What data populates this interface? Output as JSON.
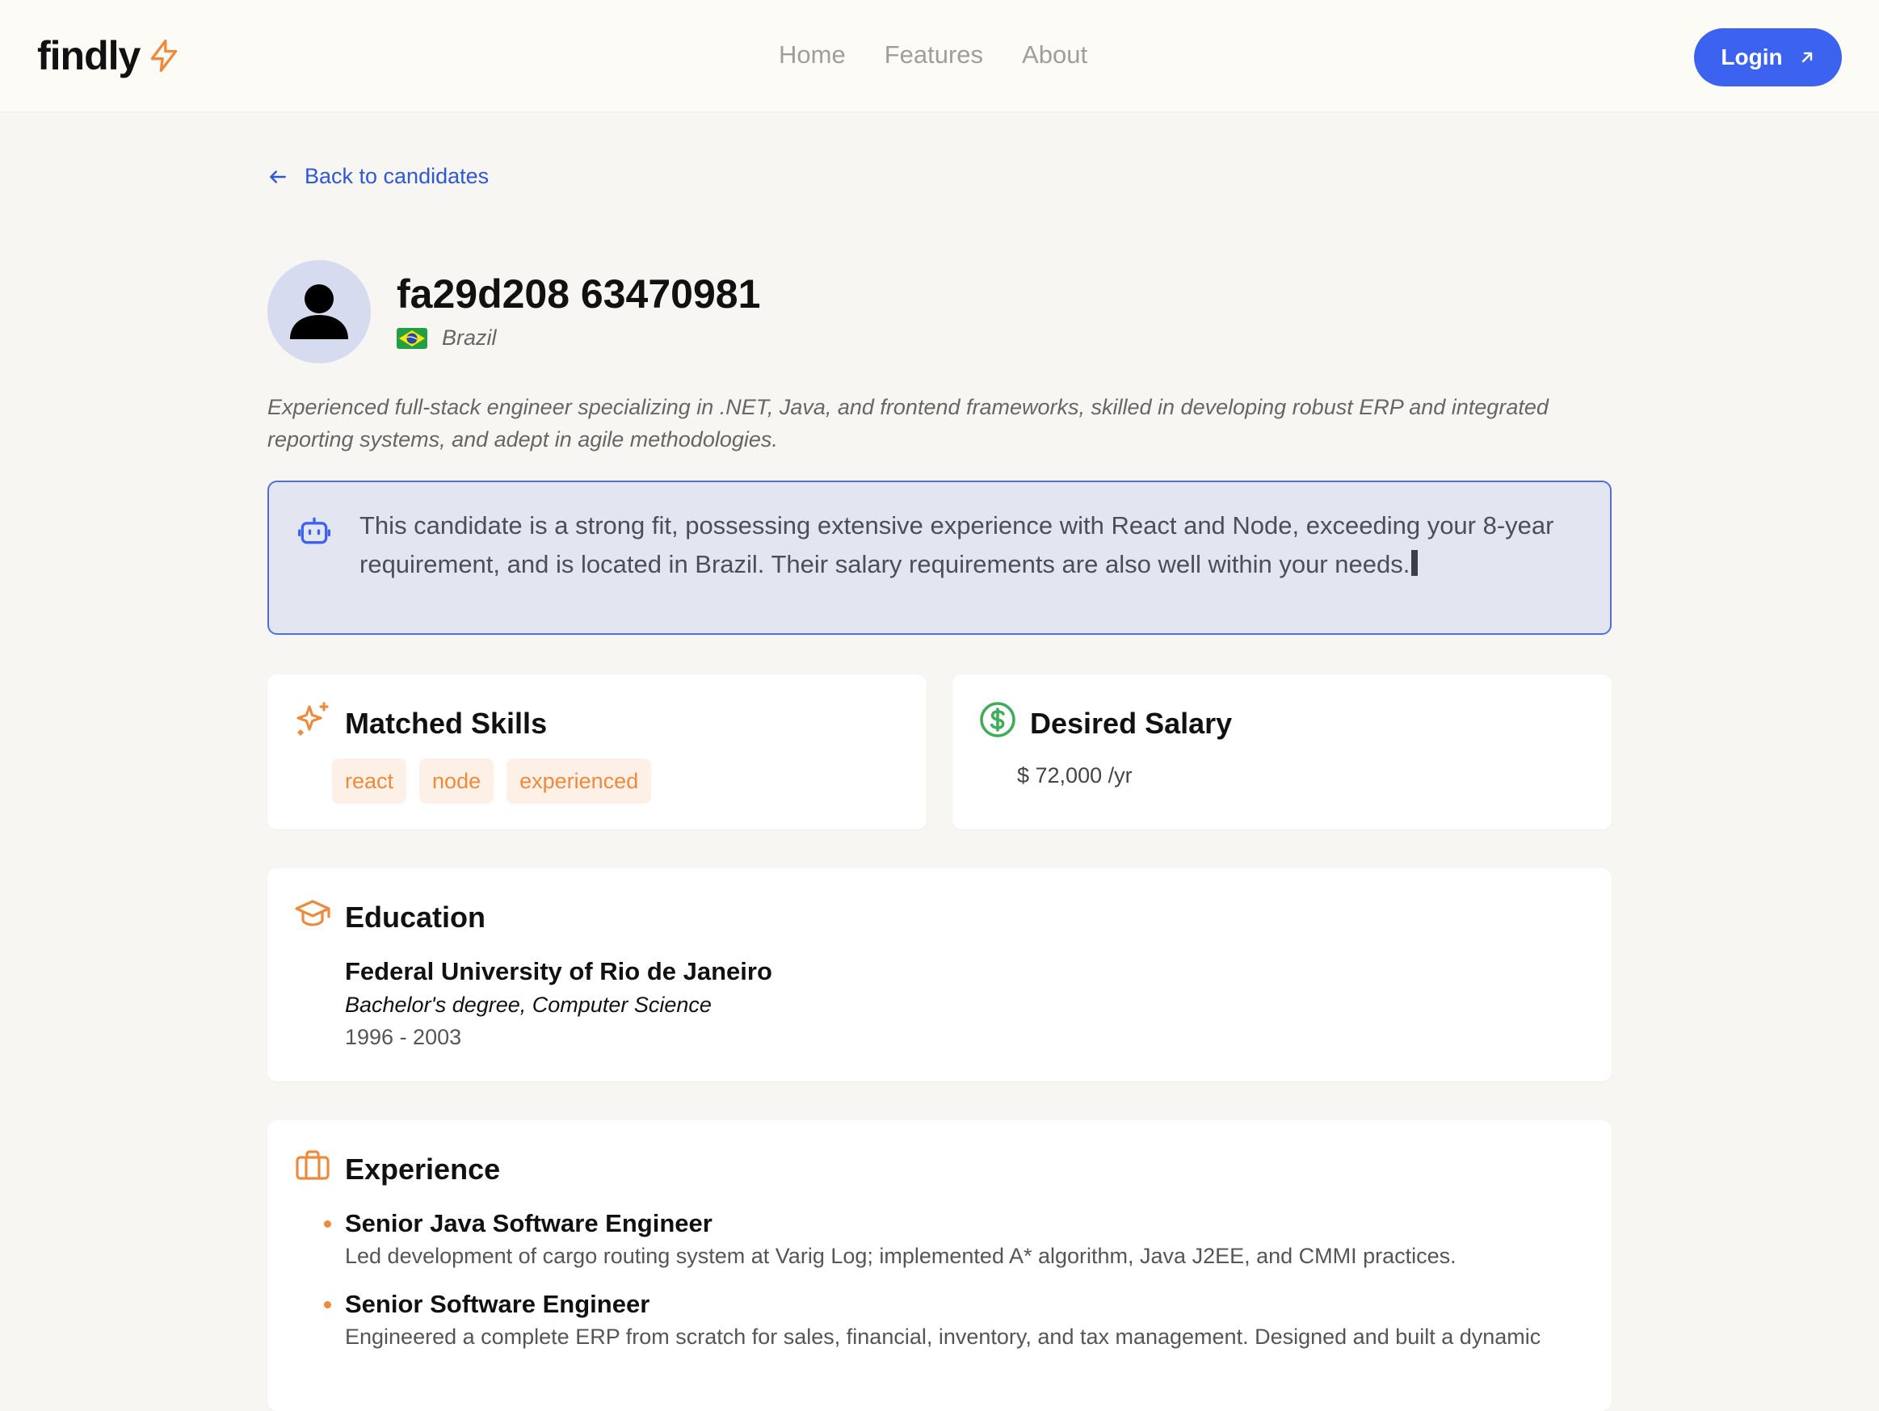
{
  "header": {
    "brand": "findly",
    "nav": [
      "Home",
      "Features",
      "About"
    ],
    "login_label": "Login"
  },
  "back_label": "Back to candidates",
  "candidate": {
    "name": "fa29d208 63470981",
    "country": "Brazil",
    "flag": "brazil-flag-icon",
    "bio": "Experienced full-stack engineer specializing in .NET, Java, and frontend frameworks, skilled in developing robust ERP and integrated reporting systems, and adept in agile methodologies."
  },
  "ai_summary": "This candidate is a strong fit, possessing extensive experience with React and Node, exceeding your 8-year requirement, and is located in Brazil. Their salary requirements are also well within your needs.",
  "skills": {
    "title": "Matched Skills",
    "items": [
      "react",
      "node",
      "experienced"
    ]
  },
  "salary": {
    "title": "Desired Salary",
    "value": "$ 72,000 /yr"
  },
  "education": {
    "title": "Education",
    "school": "Federal University of Rio de Janeiro",
    "degree": "Bachelor's degree, Computer Science",
    "years": "1996 - 2003"
  },
  "experience": {
    "title": "Experience",
    "items": [
      {
        "role": "Senior Java Software Engineer",
        "description": "Led development of cargo routing system at Varig Log; implemented A* algorithm, Java J2EE, and CMMI practices."
      },
      {
        "role": "Senior Software Engineer",
        "description": "Engineered a complete ERP from scratch for sales, financial, inventory, and tax management. Designed and built a dynamic"
      }
    ]
  },
  "colors": {
    "accent_blue": "#3b63f0",
    "accent_orange": "#ee8a3c",
    "salary_green": "#3fae5a",
    "ai_box_bg": "#e3e5f0"
  }
}
